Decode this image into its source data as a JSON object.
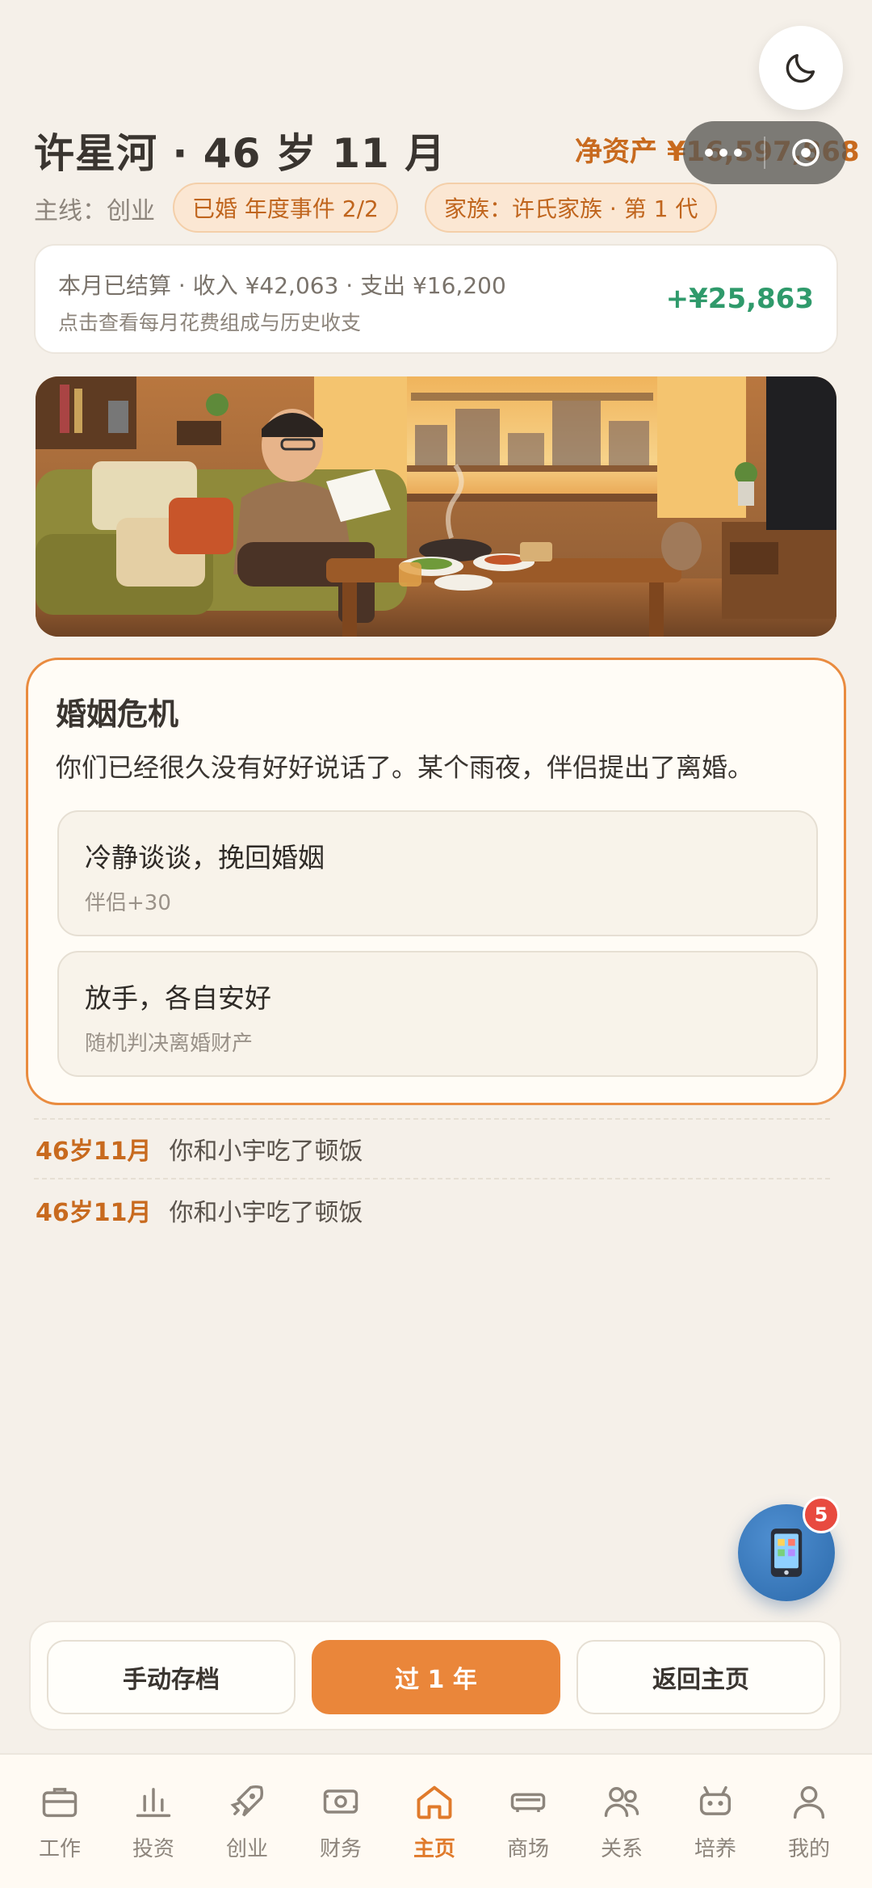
{
  "header": {
    "title": "许星河 · 46 岁 11 月",
    "net_worth": "净资产 ¥16,597,868",
    "mainline": "主线：创业",
    "badge_marriage": "已婚 年度事件 2/2",
    "badge_family": "家族：许氏家族 · 第 1 代"
  },
  "settlement": {
    "line1": "本月已结算 · 收入 ¥42,063 · 支出 ¥16,200",
    "line2": "点击查看每月花费组成与历史收支",
    "net": "+¥25,863"
  },
  "event": {
    "title": "婚姻危机",
    "description": "你们已经很久没有好好说话了。某个雨夜，伴侣提出了离婚。",
    "choices": [
      {
        "label": "冷静谈谈，挽回婚姻",
        "effect": "伴侣+30"
      },
      {
        "label": "放手，各自安好",
        "effect": "随机判决离婚财产"
      }
    ]
  },
  "log": [
    {
      "age": "46岁11月",
      "text": "你和小宇吃了顿饭"
    },
    {
      "age": "46岁11月",
      "text": "你和小宇吃了顿饭"
    }
  ],
  "phone_fab": {
    "badge_count": "5",
    "icon": "phone-icon"
  },
  "actions": {
    "save": "手动存档",
    "advance": "过 1 年",
    "home": "返回主页"
  },
  "tabs": [
    {
      "label": "工作",
      "icon": "briefcase-icon"
    },
    {
      "label": "投资",
      "icon": "bar-chart-icon"
    },
    {
      "label": "创业",
      "icon": "rocket-icon"
    },
    {
      "label": "财务",
      "icon": "cash-icon"
    },
    {
      "label": "主页",
      "icon": "home-icon",
      "active": true
    },
    {
      "label": "商场",
      "icon": "shop-icon"
    },
    {
      "label": "关系",
      "icon": "people-icon"
    },
    {
      "label": "培养",
      "icon": "robot-icon"
    },
    {
      "label": "我的",
      "icon": "person-icon"
    }
  ],
  "colors": {
    "accent": "#ea863a",
    "background": "#f5f0e9",
    "positive": "#2f9a6b",
    "badge_red": "#e84a3f",
    "fab_blue": "#2c6aab"
  }
}
